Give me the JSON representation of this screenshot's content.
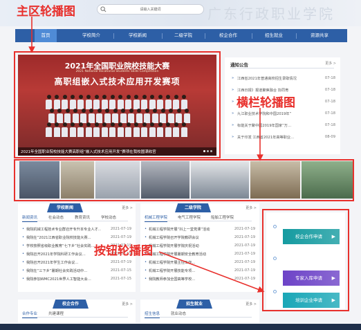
{
  "header": {
    "search_placeholder": "请输入关键词",
    "deco_text": "广东行政职业学院"
  },
  "nav": {
    "items": [
      "首页",
      "学校简介",
      "学校新闻",
      "二级学院",
      "校企合作",
      "招生就业",
      "资源共享"
    ],
    "active": 0
  },
  "banner": {
    "title_line1": "2021年全国职业院校技能大赛",
    "title_line2": "2021 National Vocational Students Skills Competition",
    "title_line3": "高职组嵌入式技术应用开发赛项",
    "caption": "2021年全国职业院校技能大赛高职组“嵌入式技术应用开发”赛项在我校圆满收官",
    "slide_count": 3,
    "active_slide": 0
  },
  "notice": {
    "title": "通知公告",
    "more": "更多 >",
    "items": [
      {
        "text": "江西省2021年普通高校招生录取情况",
        "date": "07-18"
      },
      {
        "text": "江西日报》报道聚焦融合 协同育",
        "date": "07-18"
      },
      {
        "text": "",
        "date": "07-18"
      },
      {
        "text": "九江职业技术学院和中国2019年”",
        "date": "07-18"
      },
      {
        "text": "标能关于聚中国2019年国家“万…",
        "date": "07-18"
      },
      {
        "text": "关于印发 江西省2021年高等职业…",
        "date": "08-09"
      }
    ]
  },
  "sections": {
    "news": {
      "title": "学校新闻",
      "more": "更多 >",
      "tabs": [
        "新闻资讯",
        "社会动态",
        "教育资讯",
        "学校动态"
      ],
      "items": [
        {
          "text": "我院机械工程技术专业群召开专升本专业人才…",
          "date": "2021-07-19"
        },
        {
          "text": "我院在“2021江西省职业院校技能大赛…",
          "date": "2021-07-19"
        },
        {
          "text": "学校按照省级职业教育“七下乡”社会实践…",
          "date": "2021-07-19"
        },
        {
          "text": "我院召开2021年学院科研工作会议…",
          "date": "2021-07-19"
        },
        {
          "text": "我院召开2021年学生工作会议…",
          "date": "2021-07-19"
        },
        {
          "text": "我院在“三下乡”暑期社会实践活动中…",
          "date": "2021-07-15"
        },
        {
          "text": "我院参加WMC2021世界人工智能大会…",
          "date": "2021-07-15"
        }
      ]
    },
    "college": {
      "title": "二级学院",
      "more": "更多 >",
      "tabs": [
        "机械工程学院",
        "电气工程学院",
        "船舶工程学院"
      ],
      "items": [
        {
          "text": "机械工程学院开展“抖上一堂党课”活动",
          "date": "2021-07-19"
        },
        {
          "text": "机械工程学院召开学院教研会议",
          "date": "2021-07-19"
        },
        {
          "text": "机械工程学院开展学院庆祝活动",
          "date": "2021-07-19"
        },
        {
          "text": "机械工程学院开展暑期安全教育活动",
          "date": "2021-07-19"
        },
        {
          "text": "机械工程学院开展主任工作…",
          "date": "2021-07-19"
        },
        {
          "text": "机械工程学院开展技能专项…",
          "date": "2021-07-19"
        },
        {
          "text": "我院教师参加全国高等学校…",
          "date": "2021-07-19"
        }
      ]
    },
    "coop": {
      "title": "校企合作",
      "more": "更多 >",
      "tabs": [
        "合作专业",
        "共建课程"
      ]
    },
    "admission": {
      "title": "招生就业",
      "more": "更多 >",
      "tabs": [
        "招生信息",
        "就业动态"
      ]
    }
  },
  "side_buttons": [
    {
      "label": "校企合作申请",
      "color": "#159ba0"
    },
    {
      "label": "专家入库申请",
      "color": "#6d43c7"
    },
    {
      "label": "培训企业申请",
      "color": "#1aa7b7"
    }
  ],
  "annotations": {
    "main": "主区轮播图",
    "strip": "横栏轮播图",
    "buttons": "按钮轮播图",
    "color": "#e8302c"
  }
}
